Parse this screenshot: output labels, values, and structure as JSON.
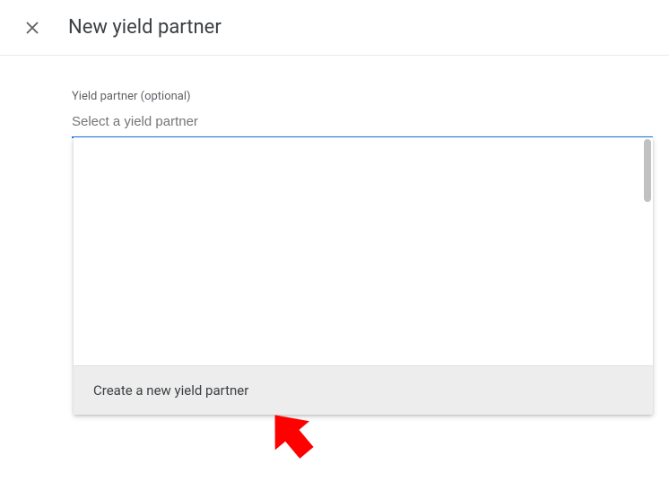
{
  "header": {
    "title": "New yield partner"
  },
  "form": {
    "field_label": "Yield partner (optional)",
    "select_placeholder": "Select a yield partner"
  },
  "dropdown": {
    "create_action": "Create a new yield partner"
  }
}
